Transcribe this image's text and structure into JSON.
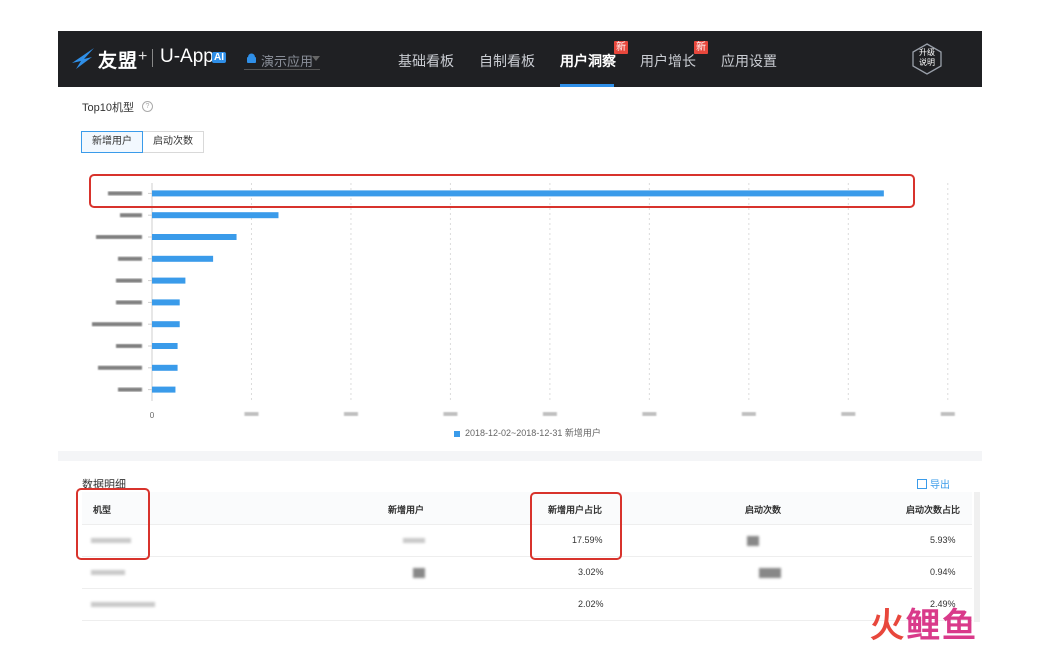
{
  "header": {
    "brand": "友盟",
    "plus": "+",
    "product": "U-App",
    "ai_badge": "AI",
    "app_select": "演示应用",
    "nav": [
      {
        "label": "基础看板"
      },
      {
        "label": "自制看板"
      },
      {
        "label": "用户洞察",
        "badge": "新"
      },
      {
        "label": "用户增长",
        "badge": "新"
      },
      {
        "label": "应用设置"
      }
    ],
    "active_nav": "用户洞察",
    "help_line1": "升级",
    "help_line2": "说明",
    "bg_color": "#1f2023",
    "accent_color": "#2f8fe8"
  },
  "chart_section": {
    "title": "Top10机型",
    "tabs": [
      {
        "label": "新增用户"
      },
      {
        "label": "启动次数"
      }
    ],
    "active_tab": "新增用户"
  },
  "chart_data": {
    "type": "bar",
    "orientation": "horizontal",
    "bar_color": "#3a9bea",
    "categories": [
      "",
      "",
      "",
      "",
      "",
      "",
      "",
      "",
      "",
      ""
    ],
    "values": [
      1030,
      178,
      119,
      86,
      47,
      39,
      39,
      36,
      36,
      33
    ],
    "xlim": [
      0,
      1140
    ],
    "xticks": [
      0,
      140,
      280,
      420,
      560,
      700,
      840,
      980,
      1120
    ],
    "xtick_labels": [
      "0",
      "",
      "",
      "",
      "",
      "",
      "",
      "",
      ""
    ],
    "legend": "2018-12-02~2018-12-31 新增用户",
    "grid": true,
    "legend_position": "bottom"
  },
  "detail_section": {
    "title": "数据明细",
    "export_label": "导出",
    "columns": [
      "机型",
      "新增用户",
      "新增用户占比",
      "启动次数",
      "启动次数占比"
    ],
    "rows": [
      {
        "model": "",
        "new_users": "",
        "new_share": "17.59%",
        "launches": "",
        "launch_share": "5.93%"
      },
      {
        "model": "",
        "new_users": "",
        "new_share": "3.02%",
        "launches": "",
        "launch_share": "0.94%"
      },
      {
        "model": "",
        "new_users": "",
        "new_share": "2.02%",
        "launches": "",
        "launch_share": "2.49%"
      }
    ]
  },
  "watermark": {
    "text_part1": "火",
    "text_part2": "鲤鱼",
    "color1": "#e8473c",
    "color2": "#d93a8a"
  }
}
